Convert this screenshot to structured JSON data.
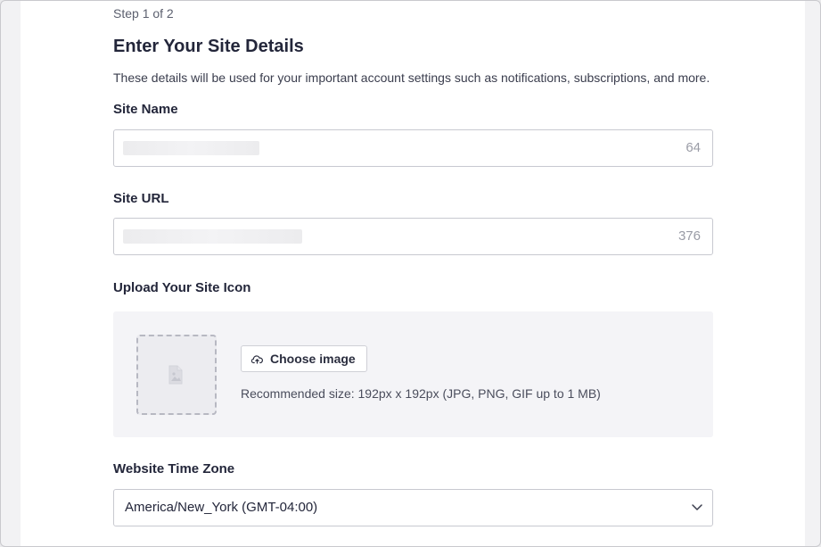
{
  "step": {
    "text": "Step 1 of 2"
  },
  "heading": {
    "title": "Enter Your Site Details"
  },
  "description": "These details will be used for your important account settings such as notifications, subscriptions, and more.",
  "site_name": {
    "label": "Site Name",
    "value": "",
    "counter": "64"
  },
  "site_url": {
    "label": "Site URL",
    "value": "",
    "counter": "376"
  },
  "site_icon": {
    "label": "Upload Your Site Icon",
    "button_label": "Choose image",
    "button_icon": "cloud-upload-icon",
    "placeholder_icon": "image-file-icon",
    "recommendation": "Recommended size: 192px x 192px (JPG, PNG, GIF up to 1 MB)"
  },
  "timezone": {
    "label": "Website Time Zone",
    "selected": "America/New_York (GMT-04:00)",
    "icon": "chevron-down-icon"
  }
}
